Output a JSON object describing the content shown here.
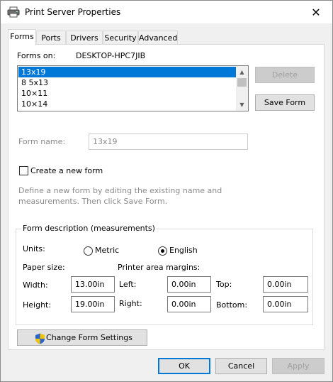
{
  "window": {
    "title": "Print Server Properties",
    "close_glyph": "✕"
  },
  "tabs": [
    {
      "label": "Forms",
      "active": true
    },
    {
      "label": "Ports",
      "active": false
    },
    {
      "label": "Drivers",
      "active": false
    },
    {
      "label": "Security",
      "active": false
    },
    {
      "label": "Advanced",
      "active": false
    }
  ],
  "forms_on": {
    "label": "Forms on:",
    "server": "DESKTOP-HPC7JIB"
  },
  "forms_list": {
    "items": [
      "13x19",
      "8 5x13",
      "10×11",
      "10×14"
    ],
    "selected": "13x19"
  },
  "buttons": {
    "delete": "Delete",
    "save_form": "Save Form",
    "change_form_settings": "Change Form Settings",
    "ok": "OK",
    "cancel": "Cancel",
    "apply": "Apply"
  },
  "form_name": {
    "label": "Form name:",
    "value": "13x19"
  },
  "create_new": {
    "label": "Create a new form",
    "checked": false
  },
  "help_text": {
    "line1": "Define a new form by editing the existing name and",
    "line2": "measurements. Then click Save Form."
  },
  "description": {
    "title": "Form description (measurements)",
    "units_label": "Units:",
    "metric_label": "Metric",
    "english_label": "English",
    "selected_unit": "English",
    "paper_size_label": "Paper size:",
    "margins_label": "Printer area margins:",
    "width_label": "Width:",
    "width_value": "13.00in",
    "height_label": "Height:",
    "height_value": "19.00in",
    "left_label": "Left:",
    "left_value": "0.00in",
    "right_label": "Right:",
    "right_value": "0.00in",
    "top_label": "Top:",
    "top_value": "0.00in",
    "bottom_label": "Bottom:",
    "bottom_value": "0.00in"
  },
  "icons": {
    "title": "printer-icon",
    "uac": "uac-shield-icon",
    "close": "close-icon"
  },
  "colors": {
    "selection": "#0078d7",
    "window_bg": "#f0f0f0",
    "panel_bg": "#ffffff"
  }
}
